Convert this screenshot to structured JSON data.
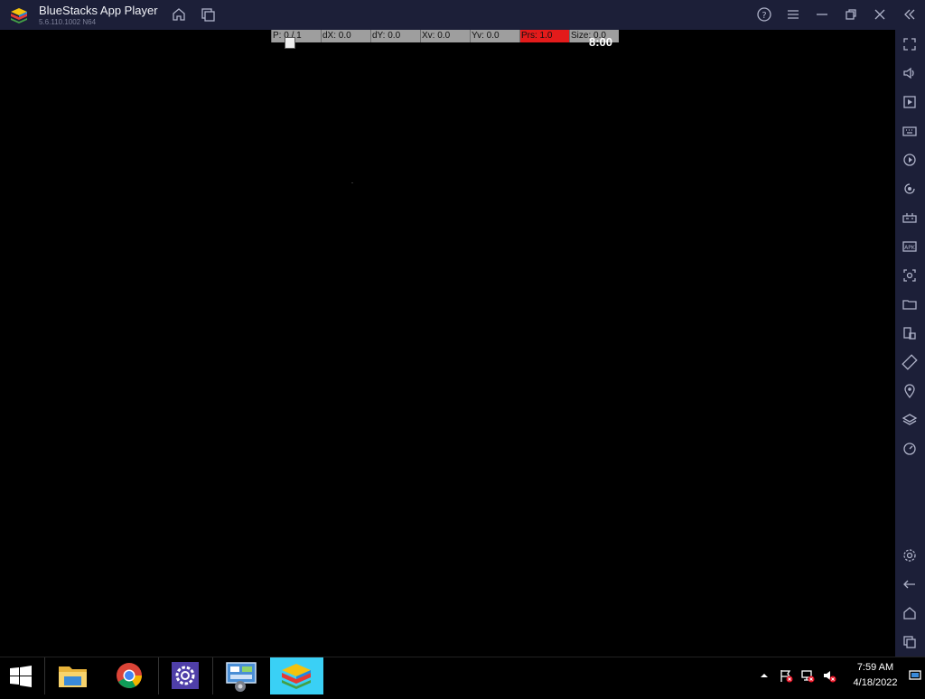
{
  "window": {
    "title": "BlueStacks App Player",
    "version": "5.6.110.1002 N64"
  },
  "titlebar_icons": [
    "home-icon",
    "multi-instance-icon",
    "help-icon",
    "menu-icon",
    "minimize-icon",
    "restore-icon",
    "close-icon",
    "collapse-sidebar-icon"
  ],
  "sidebar_icons": [
    "fullscreen-icon",
    "volume-icon",
    "play-store-icon",
    "keyboard-controls-icon",
    "macro-icon",
    "sync-icon",
    "gamepad-icon",
    "install-apk-icon",
    "screenshot-icon",
    "media-folder-icon",
    "multi-instance-icon",
    "rotate-icon",
    "location-icon",
    "layers-icon",
    "eco-mode-icon",
    "settings-icon",
    "back-icon",
    "android-home-icon",
    "recent-apps-icon"
  ],
  "pointer_overlay": {
    "cells": [
      "P: 0 / 1",
      "dX: 0.0",
      "dY: 0.0",
      "Xv: 0.0",
      "Yv: 0.0",
      "Prs: 1.0",
      "Size: 0.0"
    ],
    "time": "8:00"
  },
  "taskbar": {
    "apps": [
      "start-button",
      "file-explorer",
      "google-chrome",
      "settings",
      "control-panel",
      "bluestacks"
    ],
    "active_app": "bluestacks",
    "clock_time": "7:59 AM",
    "clock_date": "4/18/2022"
  },
  "colors": {
    "chrome": "#1c1f38",
    "overlay_gray": "#9e9e9e",
    "overlay_red": "#e31b1b",
    "taskbar_active": "#3ad0f5"
  }
}
